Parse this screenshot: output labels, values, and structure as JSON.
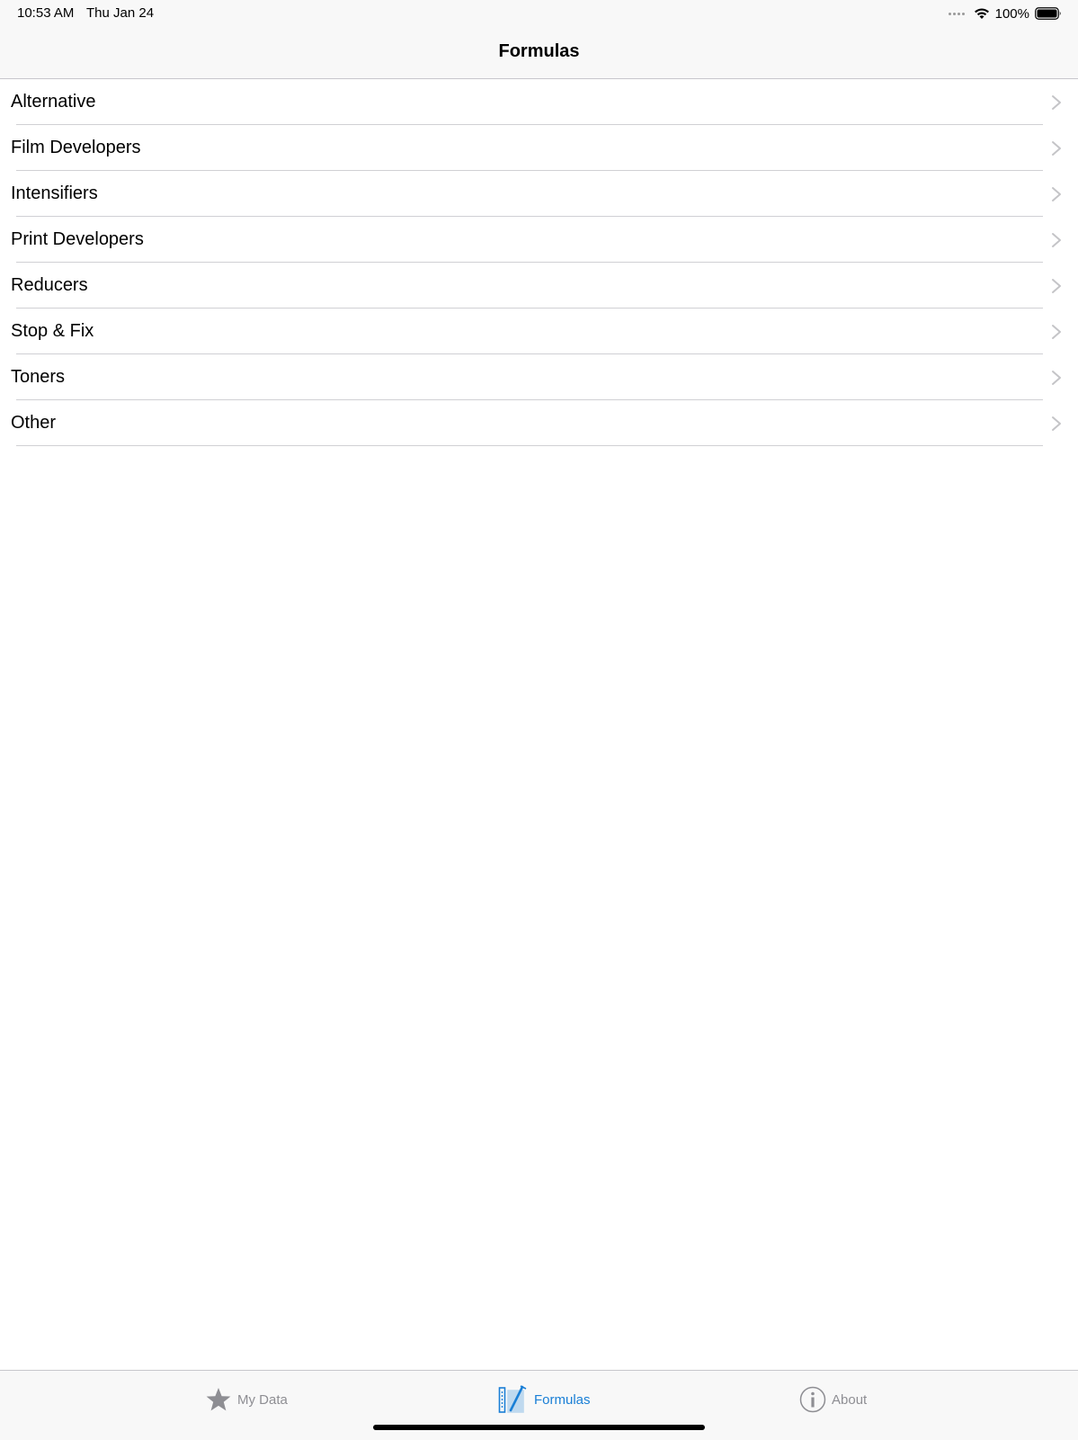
{
  "status_bar": {
    "time": "10:53 AM",
    "date": "Thu Jan 24",
    "battery_percent": "100%",
    "icons": [
      "cellular-signal-icon",
      "wifi-icon",
      "battery-icon"
    ]
  },
  "nav_bar": {
    "title": "Formulas"
  },
  "list": {
    "items": [
      {
        "label": "Alternative"
      },
      {
        "label": "Film Developers"
      },
      {
        "label": "Intensifiers"
      },
      {
        "label": "Print Developers"
      },
      {
        "label": "Reducers"
      },
      {
        "label": "Stop & Fix"
      },
      {
        "label": "Toners"
      },
      {
        "label": "Other"
      }
    ]
  },
  "tab_bar": {
    "tabs": [
      {
        "label": "My Data",
        "icon": "star-icon",
        "active": false
      },
      {
        "label": "Formulas",
        "icon": "formulas-icon",
        "active": true
      },
      {
        "label": "About",
        "icon": "info-icon",
        "active": false
      }
    ]
  },
  "colors": {
    "accent": "#1a7fd6",
    "inactive": "#8e8e93",
    "bar_background": "#f8f8f8",
    "separator": "#d0d0d4"
  }
}
